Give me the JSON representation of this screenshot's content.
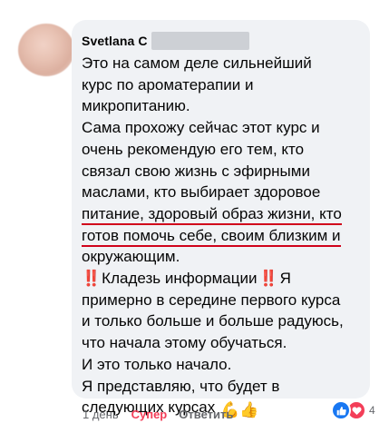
{
  "comment": {
    "author_first": "Svetlana",
    "author_last_initial": "C",
    "lines_para1": [
      "Это на самом деле сильнейший",
      "курс по ароматерапии и",
      "микропитанию."
    ],
    "lines_para2": [
      "Сама прохожу сейчас этот курс и",
      "очень рекомендую его тем, кто",
      "связал свою жизнь с эфирными",
      "маслами, кто выбирает здоровое"
    ],
    "underlined_lines": [
      "питание, здоровый образ жизни, кто",
      "готов помочь себе, своим близким и"
    ],
    "line_after_underline": "окружающим.",
    "kladez_before": "‼️",
    "kladez_text": "Кладезь информации",
    "kladez_after": "‼️",
    "kladez_tail": "Я",
    "lines_para3": [
      "примерно в середине первого курса",
      "и только больше и больше радуюсь,",
      "что начала этому обучаться.",
      "И это только начало.",
      "Я представляю, что будет в"
    ],
    "last_line": "следующих курсах",
    "last_line_emojis": "💪👍"
  },
  "actions": {
    "age": "1 день",
    "reacted": "Супер",
    "reply": "Ответить"
  },
  "reactions": {
    "icons": [
      "like-icon",
      "love-icon"
    ],
    "count": "4",
    "colors": {
      "like": "#1877f2",
      "love": "#f33e58"
    }
  }
}
